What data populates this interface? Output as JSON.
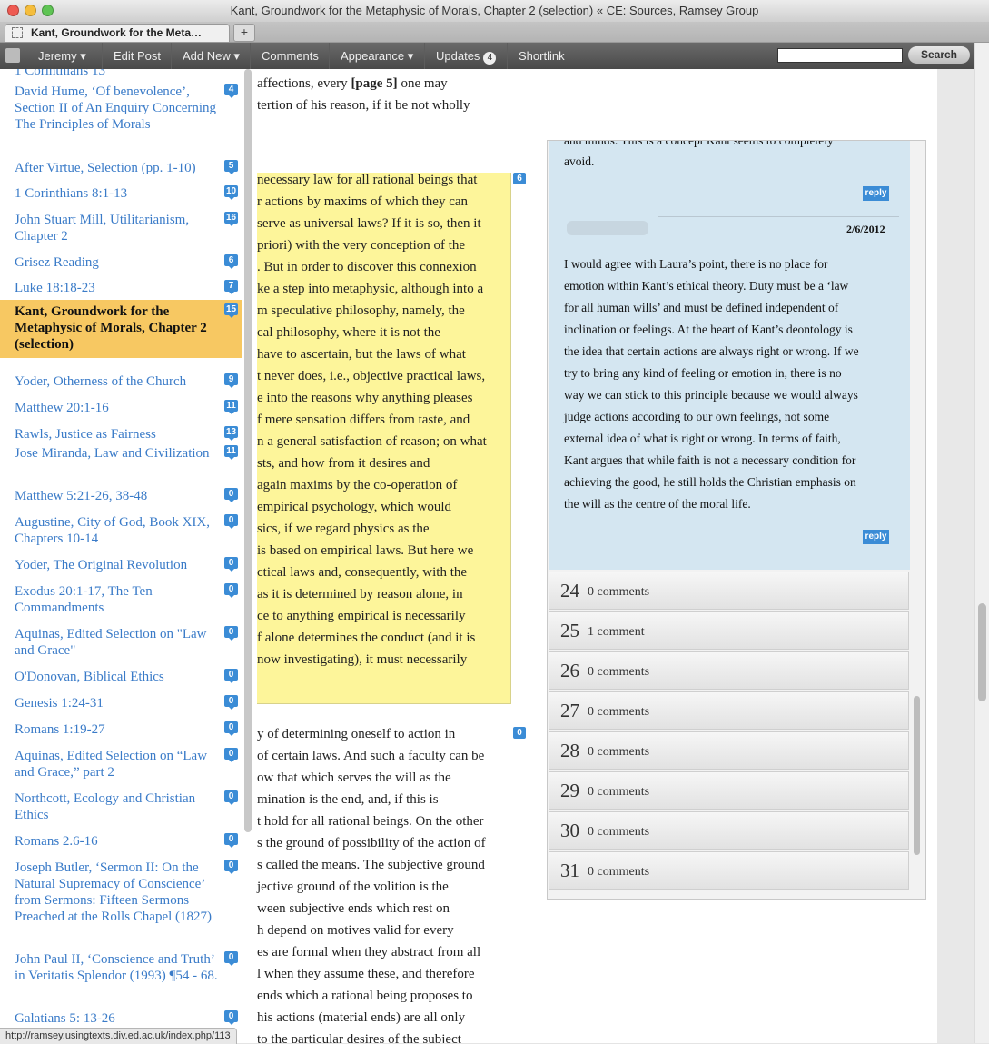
{
  "window": {
    "title": "Kant, Groundwork for the Metaphysic of Morals, Chapter 2 (selection) « CE: Sources, Ramsey Group",
    "traffic_light_colors": [
      "#ee5a52",
      "#f5bd3c",
      "#5fc454"
    ]
  },
  "tabs": [
    {
      "label": "Kant, Groundwork for the Meta…",
      "active": true
    }
  ],
  "new_tab_label": "+",
  "admin_bar": {
    "user": "Jeremy ▾",
    "edit_post": "Edit Post",
    "add_new": "Add New ▾",
    "comments": "Comments",
    "appearance": "Appearance ▾",
    "updates": "Updates",
    "updates_count": "4",
    "shortlink": "Shortlink",
    "search_placeholder": "",
    "search_button": "Search"
  },
  "sidebar": {
    "partial_top": "1 Corinthians 13",
    "items": [
      {
        "label": "David Hume, ‘Of benevolence’, Section II of An Enquiry Concerning The Principles of Morals",
        "count": "4"
      },
      {
        "label": "After Virtue, Selection (pp. 1-10)",
        "count": "5"
      },
      {
        "label": "1 Corinthians 8:1-13",
        "count": "10"
      },
      {
        "label": "John Stuart Mill, Utilitarianism, Chapter 2",
        "count": "16"
      },
      {
        "label": "Grisez Reading",
        "count": "6"
      },
      {
        "label": "Luke 18:18-23",
        "count": "7"
      },
      {
        "label": "Kant, Groundwork for the Metaphysic of Morals, Chapter 2 (selection)",
        "count": "15",
        "active": true
      },
      {
        "label": "Yoder, Otherness of the Church",
        "count": "9"
      },
      {
        "label": "Matthew 20:1-16",
        "count": "11"
      },
      {
        "label": "Rawls, Justice as Fairness",
        "count": "13"
      },
      {
        "label": "Jose Miranda, Law and Civilization",
        "count": "11"
      },
      {
        "label": "Matthew 5:21-26, 38-48",
        "count": "0"
      },
      {
        "label": "Augustine, City of God, Book XIX, Chapters 10-14",
        "count": "0"
      },
      {
        "label": "Yoder, The Original Revolution",
        "count": "0"
      },
      {
        "label": "Exodus 20:1-17, The Ten Commandments",
        "count": "0"
      },
      {
        "label": "Aquinas, Edited Selection on \"Law and Grace\"",
        "count": "0"
      },
      {
        "label": "O'Donovan, Biblical Ethics",
        "count": "0"
      },
      {
        "label": "Genesis 1:24-31",
        "count": "0"
      },
      {
        "label": "Romans 1:19-27",
        "count": "0"
      },
      {
        "label": "Aquinas, Edited Selection on “Law and Grace,” part 2",
        "count": "0"
      },
      {
        "label": "Northcott, Ecology and Christian Ethics",
        "count": "0"
      },
      {
        "label": "Romans 2.6-16",
        "count": "0"
      },
      {
        "label": "Joseph Butler, ‘Sermon II: On the Natural Supremacy of Conscience’ from Sermons: Fifteen Sermons Preached at the Rolls Chapel (1827)",
        "count": "0"
      },
      {
        "label": "John Paul II, ‘Conscience and Truth’ in Veritatis Splendor (1993) ¶54 - 68.",
        "count": "0"
      },
      {
        "label": "Galatians 5: 13-26",
        "count": "0"
      }
    ]
  },
  "article": {
    "top_lines": [
      "affections, every ",
      "tertion of his reason, if it be not wholly"
    ],
    "page_marker": "[page 5]",
    "top_line_tail": " one may",
    "highlight_count": "6",
    "highlight_lines": [
      "necessary law for all rational beings that",
      "r actions by maxims of which they can",
      "serve as universal laws? If it is so, then it",
      "priori) with the very conception of the",
      ". But in order to discover this connexion",
      "ke a step into metaphysic, although into a",
      "m speculative philosophy, namely, the",
      "cal philosophy, where it is not the",
      "have to ascertain, but the laws of what",
      "t never does, i.e., objective practical laws,",
      "e into the reasons why anything pleases",
      "f mere sensation differs from taste, and",
      "n a general satisfaction of reason; on what",
      "sts, and how from it desires and",
      " again maxims by the co-operation of",
      "empirical psychology, which would",
      "sics, if we regard physics as the",
      "is based on empirical laws. But here we",
      "ctical laws and, consequently, with the",
      " as it is determined by reason alone, in",
      "ce to anything empirical is necessarily",
      "f alone determines the conduct (and it is",
      "now investigating), it must necessarily"
    ],
    "lower_count": "0",
    "lower_lines": [
      "y of determining oneself to action in",
      "of certain laws. And such a faculty can be",
      "ow that which serves the will as the",
      "mination is the end, and, if this is",
      "t hold for all rational beings. On the other",
      "s the ground of possibility of the action of",
      "s called the means. The subjective ground",
      "jective ground of the volition is the",
      "ween subjective ends which rest on",
      "h depend on motives valid for every",
      "es are formal when they abstract from all",
      "l when they assume these, and therefore",
      "ends which a rational being proposes to",
      "his actions (material ends) are all only",
      "to the particular desires of the subject"
    ]
  },
  "comments_panel": {
    "top_lines": [
      "and minds. This is a concept Kant seems to completely",
      "avoid."
    ],
    "reply_label": "reply",
    "comment_date": "2/6/2012",
    "comment_lines": [
      "I would agree with Laura’s point, there is no place for",
      "emotion within Kant’s ethical theory. Duty must be a ‘law",
      "for all human wills’ and must be defined independent of",
      "inclination or feelings. At the heart of Kant’s deontology is",
      "the idea that certain actions are always right or wrong. If we",
      "try to bring any kind of feeling or emotion in, there is no",
      "way we can stick to this principle because we would always",
      "judge actions according to our own feelings, not some",
      "external idea of what is right or wrong. In terms of faith,",
      "Kant argues that while faith is not a necessary condition for",
      "achieving the good, he still holds the Christian emphasis on",
      "the will as the centre of the moral life."
    ],
    "paragraphs": [
      {
        "num": "24",
        "count": "0 comments"
      },
      {
        "num": "25",
        "count": "1 comment"
      },
      {
        "num": "26",
        "count": "0 comments"
      },
      {
        "num": "27",
        "count": "0 comments"
      },
      {
        "num": "28",
        "count": "0 comments"
      },
      {
        "num": "29",
        "count": "0 comments"
      },
      {
        "num": "30",
        "count": "0 comments"
      },
      {
        "num": "31",
        "count": "0 comments"
      }
    ]
  },
  "status_bar": "http://ramsey.usingtexts.div.ed.ac.uk/index.php/113"
}
